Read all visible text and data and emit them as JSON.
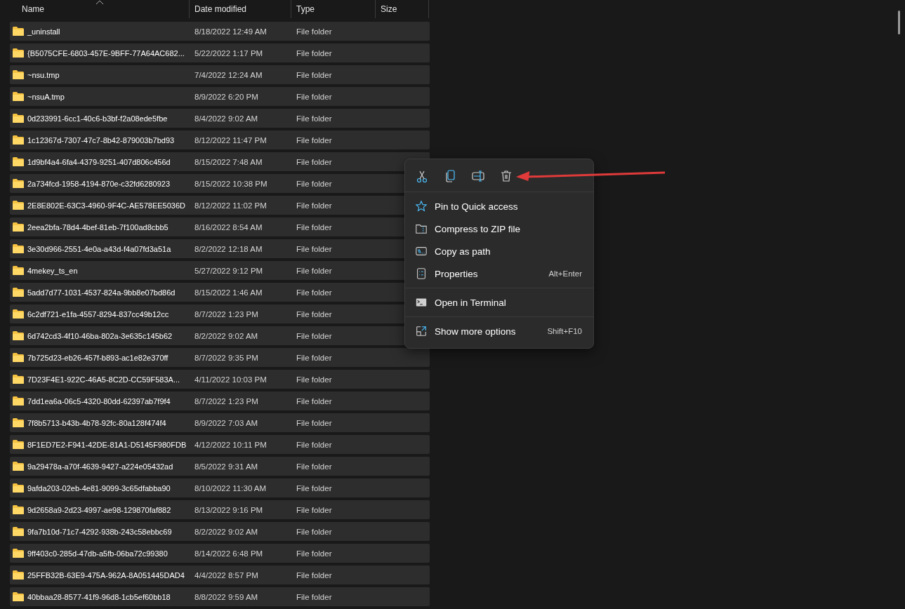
{
  "columns": [
    {
      "label": "Name",
      "sorted": true
    },
    {
      "label": "Date modified",
      "sorted": false
    },
    {
      "label": "Type",
      "sorted": false
    },
    {
      "label": "Size",
      "sorted": false
    }
  ],
  "rows": [
    {
      "name": "_uninstall",
      "date": "8/18/2022 12:49 AM",
      "type": "File folder",
      "selected": true
    },
    {
      "name": "{B5075CFE-6803-457E-9BFF-77A64AC682...",
      "date": "5/22/2022 1:17 PM",
      "type": "File folder",
      "selected": true
    },
    {
      "name": "~nsu.tmp",
      "date": "7/4/2022 12:24 AM",
      "type": "File folder",
      "selected": true
    },
    {
      "name": "~nsuA.tmp",
      "date": "8/9/2022 6:20 PM",
      "type": "File folder",
      "selected": true
    },
    {
      "name": "0d233991-6cc1-40c6-b3bf-f2a08ede5fbe",
      "date": "8/4/2022 9:02 AM",
      "type": "File folder",
      "selected": true
    },
    {
      "name": "1c12367d-7307-47c7-8b42-879003b7bd93",
      "date": "8/12/2022 11:47 PM",
      "type": "File folder",
      "selected": true
    },
    {
      "name": "1d9bf4a4-6fa4-4379-9251-407d806c456d",
      "date": "8/15/2022 7:48 AM",
      "type": "File folder",
      "selected": true
    },
    {
      "name": "2a734fcd-1958-4194-870e-c32fd6280923",
      "date": "8/15/2022 10:38 PM",
      "type": "File folder",
      "selected": true
    },
    {
      "name": "2E8E802E-63C3-4960-9F4C-AE578EE5036D",
      "date": "8/12/2022 11:02 PM",
      "type": "File folder",
      "selected": true
    },
    {
      "name": "2eea2bfa-78d4-4bef-81eb-7f100ad8cbb5",
      "date": "8/16/2022 8:54 AM",
      "type": "File folder",
      "selected": true
    },
    {
      "name": "3e30d966-2551-4e0a-a43d-f4a07fd3a51a",
      "date": "8/2/2022 12:18 AM",
      "type": "File folder",
      "selected": true
    },
    {
      "name": "4mekey_ts_en",
      "date": "5/27/2022 9:12 PM",
      "type": "File folder",
      "selected": true
    },
    {
      "name": "5add7d77-1031-4537-824a-9bb8e07bd86d",
      "date": "8/15/2022 1:46 AM",
      "type": "File folder",
      "selected": true
    },
    {
      "name": "6c2df721-e1fa-4557-8294-837cc49b12cc",
      "date": "8/7/2022 1:23 PM",
      "type": "File folder",
      "selected": true
    },
    {
      "name": "6d742cd3-4f10-46ba-802a-3e635c145b62",
      "date": "8/2/2022 9:02 AM",
      "type": "File folder",
      "selected": true
    },
    {
      "name": "7b725d23-eb26-457f-b893-ac1e82e370ff",
      "date": "8/7/2022 9:35 PM",
      "type": "File folder",
      "selected": true
    },
    {
      "name": "7D23F4E1-922C-46A5-8C2D-CC59F583A...",
      "date": "4/11/2022 10:03 PM",
      "type": "File folder",
      "selected": true
    },
    {
      "name": "7dd1ea6a-06c5-4320-80dd-62397ab7f9f4",
      "date": "8/7/2022 1:23 PM",
      "type": "File folder",
      "selected": true
    },
    {
      "name": "7f8b5713-b43b-4b78-92fc-80a128f474f4",
      "date": "8/9/2022 7:03 AM",
      "type": "File folder",
      "selected": true
    },
    {
      "name": "8F1ED7E2-F941-42DE-81A1-D5145F980FDB",
      "date": "4/12/2022 10:11 PM",
      "type": "File folder",
      "selected": true
    },
    {
      "name": "9a29478a-a70f-4639-9427-a224e05432ad",
      "date": "8/5/2022 9:31 AM",
      "type": "File folder",
      "selected": true
    },
    {
      "name": "9afda203-02eb-4e81-9099-3c65dfabba90",
      "date": "8/10/2022 11:30 AM",
      "type": "File folder",
      "selected": true
    },
    {
      "name": "9d2658a9-2d23-4997-ae98-129870faf882",
      "date": "8/13/2022 9:16 PM",
      "type": "File folder",
      "selected": true
    },
    {
      "name": "9fa7b10d-71c7-4292-938b-243c58ebbc69",
      "date": "8/2/2022 9:02 AM",
      "type": "File folder",
      "selected": true
    },
    {
      "name": "9ff403c0-285d-47db-a5fb-06ba72c99380",
      "date": "8/14/2022 6:48 PM",
      "type": "File folder",
      "selected": true
    },
    {
      "name": "25FFB32B-63E9-475A-962A-8A051445DAD4",
      "date": "4/4/2022 8:57 PM",
      "type": "File folder",
      "selected": true
    },
    {
      "name": "40bbaa28-8577-41f9-96d8-1cb5ef60bb18",
      "date": "8/8/2022 9:59 AM",
      "type": "File folder",
      "selected": true
    }
  ],
  "context_menu": {
    "groups": [
      [
        {
          "label": "Pin to Quick access"
        },
        {
          "label": "Compress to ZIP file"
        },
        {
          "label": "Copy as path"
        },
        {
          "label": "Properties",
          "shortcut": "Alt+Enter"
        }
      ],
      [
        {
          "label": "Open in Terminal"
        }
      ],
      [
        {
          "label": "Show more options",
          "shortcut": "Shift+F10"
        }
      ]
    ]
  }
}
